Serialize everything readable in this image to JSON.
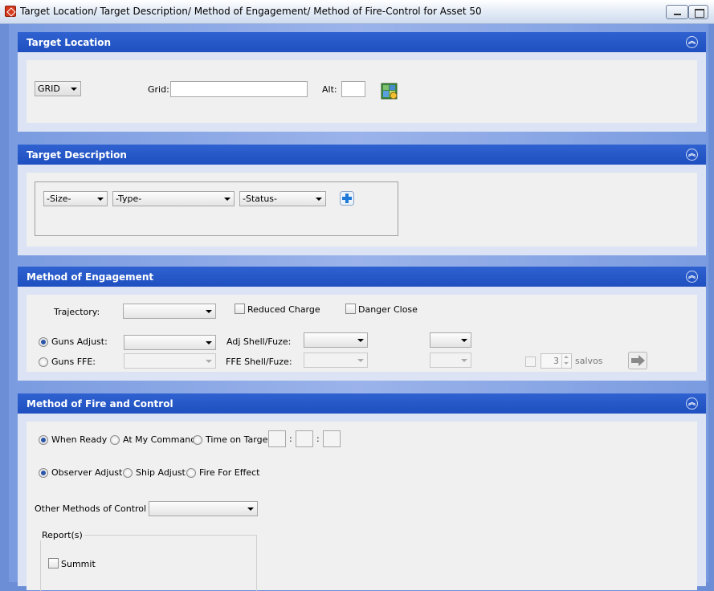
{
  "window": {
    "title": "Target Location/ Target Description/ Method of Engagement/ Method of Fire-Control for Asset 50"
  },
  "target_location": {
    "header": "Target Location",
    "coord_type": "GRID",
    "grid_label": "Grid:",
    "grid_value": "",
    "alt_label": "Alt:",
    "alt_value": "",
    "map_button_icon": "map-icon"
  },
  "target_description": {
    "header": "Target Description",
    "size": "-Size-",
    "type": "-Type-",
    "status": "-Status-",
    "add_icon": "plus-icon"
  },
  "method_of_engagement": {
    "header": "Method of Engagement",
    "trajectory_label": "Trajectory:",
    "trajectory_value": "",
    "reduced_charge_label": "Reduced Charge",
    "danger_close_label": "Danger Close",
    "guns_adjust_label": "Guns Adjust:",
    "guns_adjust_value": "",
    "adj_shell_label": "Adj Shell/Fuze:",
    "adj_shell_value": "",
    "adj_fuze_value": "",
    "guns_ffe_label": "Guns FFE:",
    "guns_ffe_value": "",
    "ffe_shell_label": "FFE Shell/Fuze:",
    "ffe_shell_value": "",
    "ffe_fuze_value": "",
    "salvos_value": "3",
    "salvos_label": "salvos",
    "forward_icon": "arrow-right-icon"
  },
  "method_of_fire": {
    "header": "Method of Fire and Control",
    "when_ready_label": "When Ready",
    "at_my_command_label": "At My Command",
    "time_on_target_label": "Time on Target",
    "time_sep": ":",
    "observer_adjust_label": "Observer Adjust",
    "ship_adjust_label": "Ship Adjust",
    "fire_for_effect_label": "Fire For Effect",
    "other_methods_label": "Other Methods of Control",
    "other_methods_value": "",
    "reports_label": "Report(s)",
    "summit_label": "Summit"
  },
  "colors": {
    "header_blue": "#2856c8",
    "panel_bg": "#f0f0f0",
    "frame_bg": "#7a9be0"
  }
}
